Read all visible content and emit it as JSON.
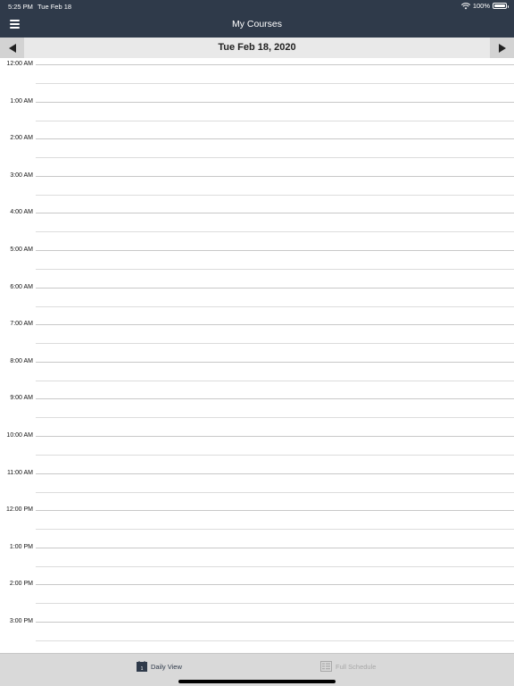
{
  "status_bar": {
    "time": "5:25 PM",
    "date": "Tue Feb 18",
    "battery": "100%"
  },
  "nav": {
    "title": "My Courses"
  },
  "date_nav": {
    "current_date": "Tue Feb 18, 2020"
  },
  "schedule": {
    "hours": [
      "12:00 AM",
      "1:00 AM",
      "2:00 AM",
      "3:00 AM",
      "4:00 AM",
      "5:00 AM",
      "6:00 AM",
      "7:00 AM",
      "8:00 AM",
      "9:00 AM",
      "10:00 AM",
      "11:00 AM",
      "12:00 PM",
      "1:00 PM",
      "2:00 PM",
      "3:00 PM"
    ]
  },
  "tabs": [
    {
      "label": "Daily View",
      "icon": "calendar-icon",
      "active": true
    },
    {
      "label": "Full Schedule",
      "icon": "schedule-list-icon",
      "active": false
    }
  ],
  "colors": {
    "nav_bg": "#2f3a4a",
    "tab_bar_bg": "#d9d9d9",
    "active_tab": "#2f3a4a",
    "inactive_tab": "#a8a8a8"
  }
}
